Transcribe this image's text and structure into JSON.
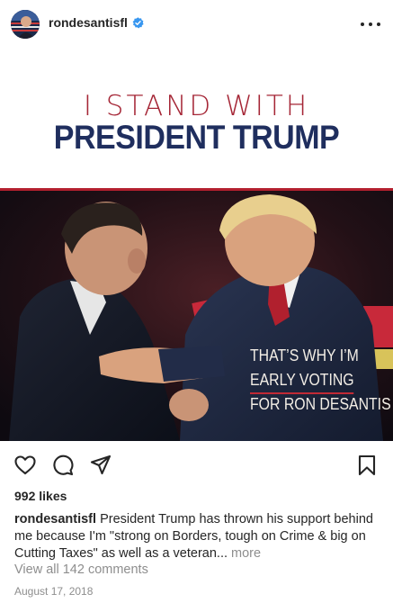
{
  "header": {
    "username": "rondesantisfl",
    "verified": true,
    "more_icon": "more-horizontal-icon"
  },
  "post_image": {
    "headline_top": "I STAND WITH",
    "headline_bottom": "PRESIDENT TRUMP",
    "overlay_line1": "THAT’S WHY I’M",
    "overlay_line2": "EARLY VOTING",
    "overlay_line3": "FOR RON DESANTIS",
    "colors": {
      "headline_red": "#a52636",
      "headline_navy": "#1f2e5e",
      "rule_red": "#b3202e"
    }
  },
  "actions": {
    "like_icon": "heart-icon",
    "comment_icon": "comment-icon",
    "share_icon": "send-icon",
    "save_icon": "bookmark-icon"
  },
  "post": {
    "likes": "992 likes",
    "caption_user": "rondesantisfl",
    "caption_text": "President Trump has thrown his support behind me because I'm \"strong on Borders, tough on Crime & big on Cutting Taxes\" as well as a veteran...",
    "caption_more": "more",
    "view_comments": "View all 142 comments",
    "date": "August 17, 2018"
  }
}
